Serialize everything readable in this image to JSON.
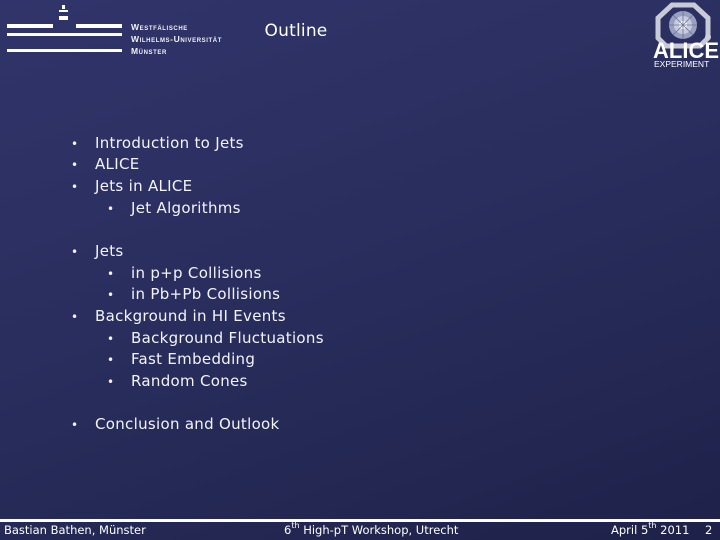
{
  "header": {
    "university_logo": {
      "line1": "Westfälische",
      "line2": "Wilhelms-Universität",
      "line3": "Münster"
    },
    "title": "Outline",
    "experiment_logo": {
      "name": "ALICE",
      "subtitle": "EXPERIMENT"
    }
  },
  "outline": [
    {
      "level": 1,
      "text": "Introduction to Jets"
    },
    {
      "level": 1,
      "text": "ALICE"
    },
    {
      "level": 1,
      "text": "Jets in ALICE"
    },
    {
      "level": 2,
      "text": "Jet Algorithms"
    },
    {
      "level": 1,
      "text": "Jets"
    },
    {
      "level": 2,
      "text": "in p+p Collisions"
    },
    {
      "level": 2,
      "text": "in Pb+Pb Collisions"
    },
    {
      "level": 1,
      "text": "Background in HI Events"
    },
    {
      "level": 2,
      "text": "Background Fluctuations"
    },
    {
      "level": 2,
      "text": "Fast Embedding"
    },
    {
      "level": 2,
      "text": "Random Cones"
    },
    {
      "level": 1,
      "text": "Conclusion and Outlook"
    }
  ],
  "footer": {
    "author": "Bastian Bathen, Münster",
    "event_prefix": "6",
    "event_sup": "th",
    "event_rest": " High-pT Workshop, Utrecht",
    "date_prefix": "April 5",
    "date_sup": "th",
    "date_rest": " 2011",
    "page_number": "2"
  },
  "colors": {
    "background_top": "#30346a",
    "background_bottom": "#1e2249",
    "text": "#ffffff"
  }
}
